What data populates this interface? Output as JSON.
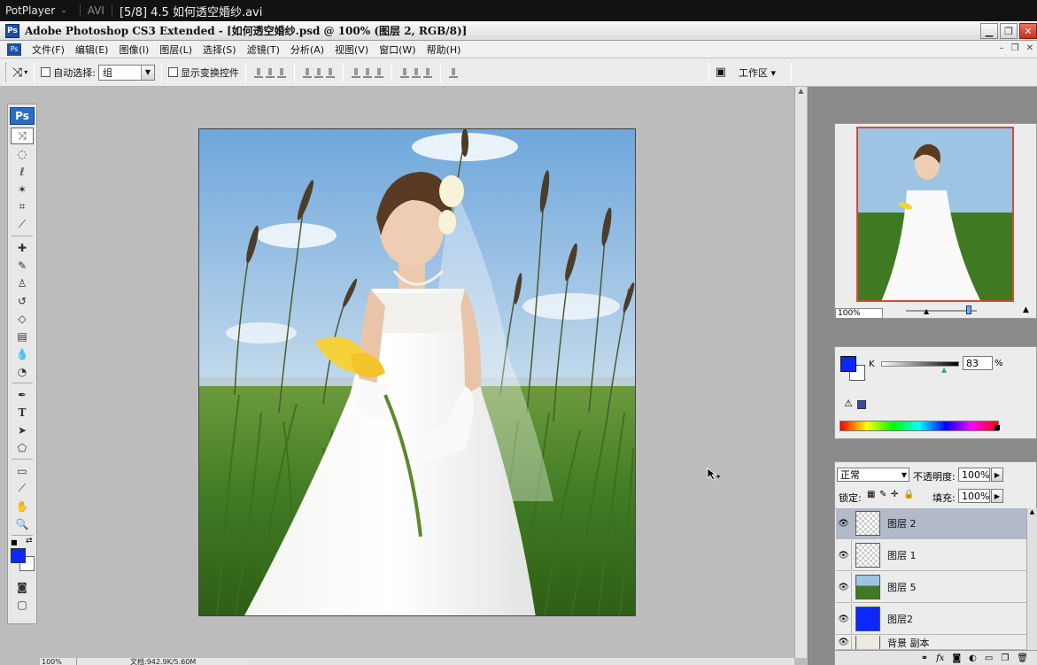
{
  "player": {
    "brand": "PotPlayer",
    "format": "AVI",
    "title": "[5/8] 4.5 如何透空婚纱.avi"
  },
  "window": {
    "title": "Adobe Photoshop CS3 Extended - [如何透空婚纱.psd @ 100% (图层 2, RGB/8)]",
    "logo": "Ps"
  },
  "menu": {
    "items": [
      "文件(F)",
      "编辑(E)",
      "图像(I)",
      "图层(L)",
      "选择(S)",
      "滤镜(T)",
      "分析(A)",
      "视图(V)",
      "窗口(W)",
      "帮助(H)"
    ]
  },
  "options": {
    "auto_select_label": "自动选择:",
    "auto_select_value": "组",
    "show_transform_label": "显示变换控件",
    "workspace_label": "工作区 ▾"
  },
  "toolbox": {
    "logo": "Ps"
  },
  "navigator": {
    "zoom": "100%"
  },
  "color": {
    "channel": "K",
    "value": "83",
    "unit": "%",
    "fg_color": "#0a28ff",
    "bg_color": "#ffffff"
  },
  "layers": {
    "blend_mode": "正常",
    "opacity_label": "不透明度:",
    "opacity": "100%",
    "lock_label": "锁定:",
    "fill_label": "填充:",
    "fill": "100%",
    "items": [
      {
        "name": "图层 2",
        "active": true,
        "thumb": "checker"
      },
      {
        "name": "图层 1",
        "active": false,
        "thumb": "checker"
      },
      {
        "name": "图层 5",
        "active": false,
        "thumb": "grass"
      },
      {
        "name": "图层2",
        "active": false,
        "thumb": "blue"
      },
      {
        "name": "背景 副本",
        "active": false,
        "thumb": "photo"
      }
    ]
  },
  "status": {
    "zoom": "100%",
    "doc": "文档:942.9K/5.60M"
  }
}
